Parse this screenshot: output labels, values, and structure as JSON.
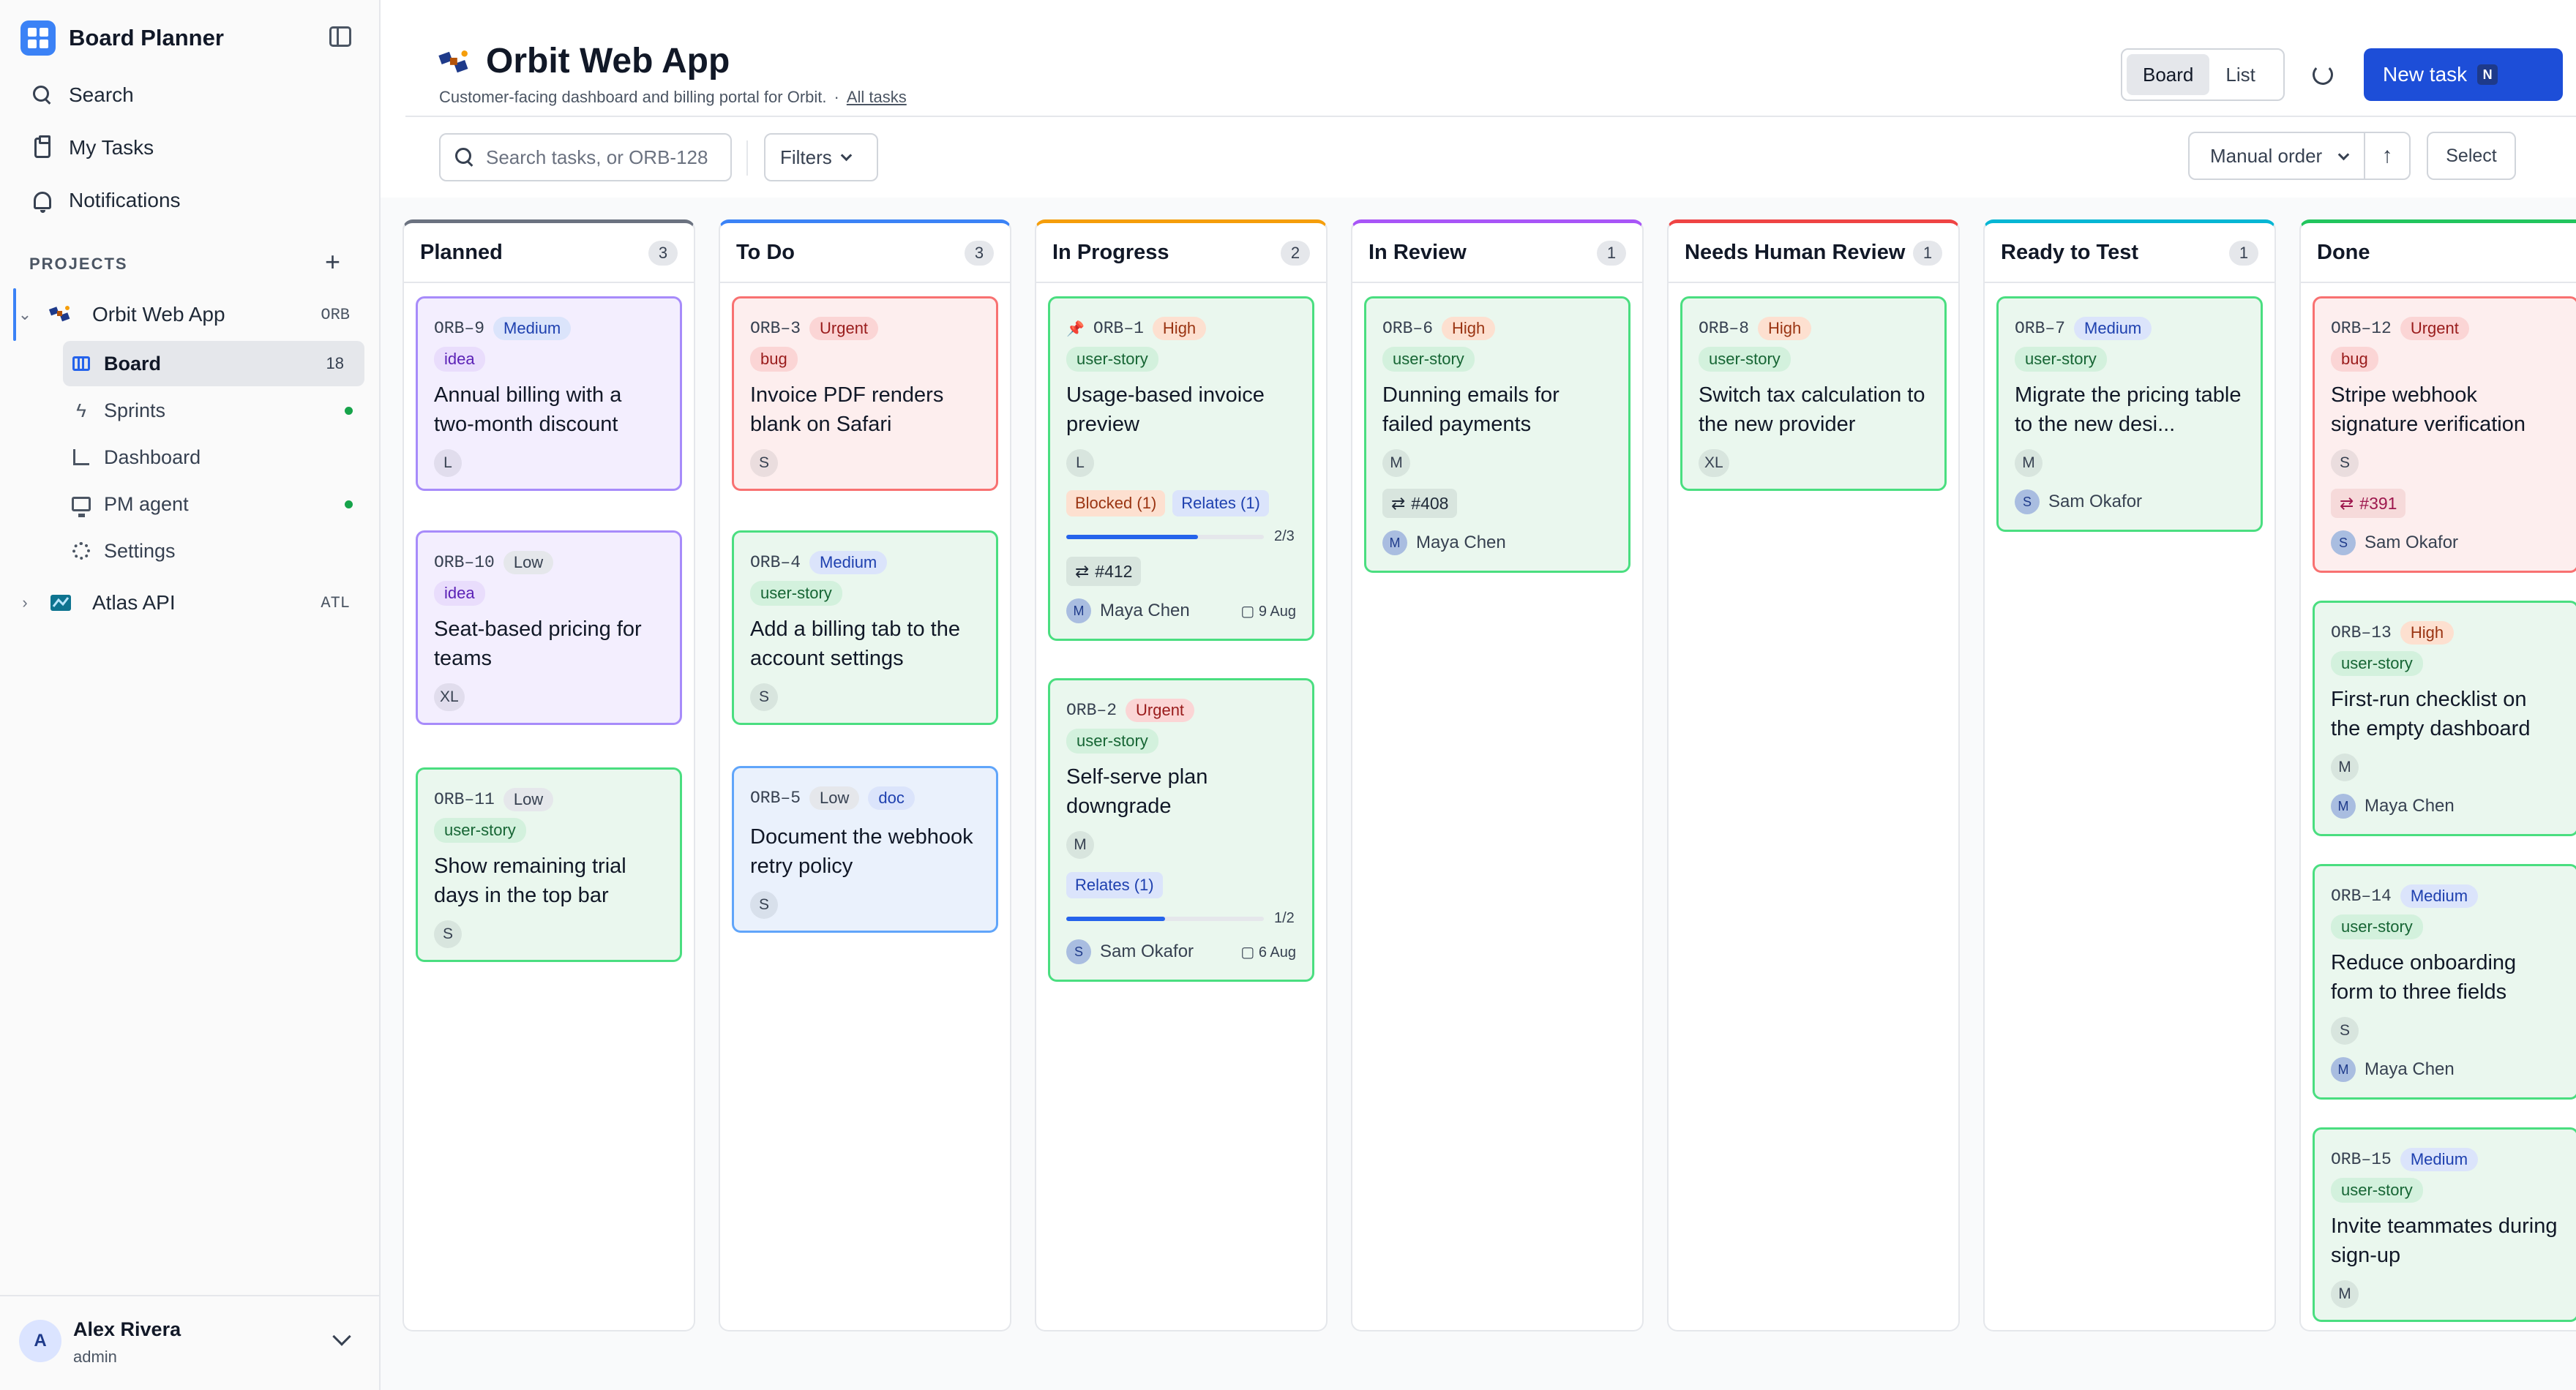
{
  "app": {
    "title": "Board Planner"
  },
  "sidebar": {
    "nav": [
      {
        "label": "Search",
        "icon": "search-icon"
      },
      {
        "label": "My Tasks",
        "icon": "clipboard-icon"
      },
      {
        "label": "Notifications",
        "icon": "bell-icon"
      }
    ],
    "projects_label": "PROJECTS",
    "projects": [
      {
        "name": "Orbit Web App",
        "key": "ORB"
      },
      {
        "name": "Atlas API",
        "key": "ATL"
      }
    ],
    "subnav": [
      {
        "label": "Board",
        "count": "18",
        "active": true
      },
      {
        "label": "Sprints",
        "dot": true
      },
      {
        "label": "Dashboard"
      },
      {
        "label": "PM agent",
        "dot": true
      },
      {
        "label": "Settings"
      }
    ],
    "user": {
      "initial": "A",
      "name": "Alex Rivera",
      "role": "admin"
    }
  },
  "header": {
    "title": "Orbit Web App",
    "description": "Customer-facing dashboard and billing portal for Orbit.",
    "separator": "·",
    "link": "All tasks",
    "view_options": [
      "Board",
      "List"
    ],
    "active_view": "Board",
    "new_task_label": "New task",
    "new_task_shortcut": "N"
  },
  "toolbar": {
    "search_placeholder": "Search tasks, or ORB-128",
    "filters_label": "Filters",
    "order_label": "Manual order",
    "sort_glyph": "↑",
    "select_label": "Select"
  },
  "columns": [
    {
      "title": "Planned",
      "count": "3",
      "accent": "#6b7280"
    },
    {
      "title": "To Do",
      "count": "3",
      "accent": "#3b82f6"
    },
    {
      "title": "In Progress",
      "count": "2",
      "accent": "#f59e0b"
    },
    {
      "title": "In Review",
      "count": "1",
      "accent": "#a855f7"
    },
    {
      "title": "Needs Human Review",
      "count": "1",
      "accent": "#ef4444"
    },
    {
      "title": "Ready to Test",
      "count": "1",
      "accent": "#06b6d4"
    },
    {
      "title": "Done",
      "count": "",
      "accent": "#22c55e"
    }
  ],
  "cards": {
    "orb9": {
      "id": "ORB–9",
      "priority": "Medium",
      "tag": "idea",
      "title": "Annual billing with a two-month discount",
      "size": "L"
    },
    "orb10": {
      "id": "ORB–10",
      "priority": "Low",
      "tag": "idea",
      "title": "Seat-based pricing for teams",
      "size": "XL"
    },
    "orb11": {
      "id": "ORB–11",
      "priority": "Low",
      "tag": "user-story",
      "title": "Show remaining trial days in the top bar",
      "size": "S"
    },
    "orb3": {
      "id": "ORB–3",
      "priority": "Urgent",
      "tag": "bug",
      "title": "Invoice PDF renders blank on Safari",
      "size": "S"
    },
    "orb4": {
      "id": "ORB–4",
      "priority": "Medium",
      "tag": "user-story",
      "title": "Add a billing tab to the account settings",
      "size": "S"
    },
    "orb5": {
      "id": "ORB–5",
      "priority": "Low",
      "tag2": "doc",
      "title": "Document the webhook retry policy",
      "size": "S"
    },
    "orb1": {
      "id": "ORB–1",
      "priority": "High",
      "tag": "user-story",
      "title": "Usage-based invoice preview",
      "size": "L",
      "blocked": "Blocked (1)",
      "relates": "Relates (1)",
      "progress_text": "2/3",
      "progress": 0.667,
      "pr": "#412",
      "assignee_initial": "M",
      "assignee": "Maya Chen",
      "due": "9 Aug"
    },
    "orb2": {
      "id": "ORB–2",
      "priority": "Urgent",
      "tag": "user-story",
      "title": "Self-serve plan downgrade",
      "size": "M",
      "relates": "Relates (1)",
      "progress_text": "1/2",
      "progress": 0.5,
      "assignee_initial": "S",
      "assignee": "Sam Okafor",
      "due": "6 Aug"
    },
    "orb6": {
      "id": "ORB–6",
      "priority": "High",
      "tag": "user-story",
      "title": "Dunning emails for failed payments",
      "size": "M",
      "pr": "#408",
      "assignee_initial": "M",
      "assignee": "Maya Chen"
    },
    "orb8": {
      "id": "ORB–8",
      "priority": "High",
      "tag": "user-story",
      "title": "Switch tax calculation to the new provider",
      "size": "XL"
    },
    "orb7": {
      "id": "ORB–7",
      "priority": "Medium",
      "tag": "user-story",
      "title": "Migrate the pricing table to the new desi...",
      "size": "M",
      "assignee_initial": "S",
      "assignee": "Sam Okafor"
    },
    "orb12": {
      "id": "ORB–12",
      "priority": "Urgent",
      "tag": "bug",
      "title": "Stripe webhook signature verification",
      "size": "S",
      "pr": "#391",
      "assignee_initial": "S",
      "assignee": "Sam Okafor"
    },
    "orb13": {
      "id": "ORB–13",
      "priority": "High",
      "tag": "user-story",
      "title": "First-run checklist on the empty dashboard",
      "size": "M",
      "assignee_initial": "M",
      "assignee": "Maya Chen"
    },
    "orb14": {
      "id": "ORB–14",
      "priority": "Medium",
      "tag": "user-story",
      "title": "Reduce onboarding form to three fields",
      "size": "S",
      "assignee_initial": "M",
      "assignee": "Maya Chen"
    },
    "orb15": {
      "id": "ORB–15",
      "priority": "Medium",
      "tag": "user-story",
      "title": "Invite teammates during sign-up",
      "size": "M"
    }
  }
}
